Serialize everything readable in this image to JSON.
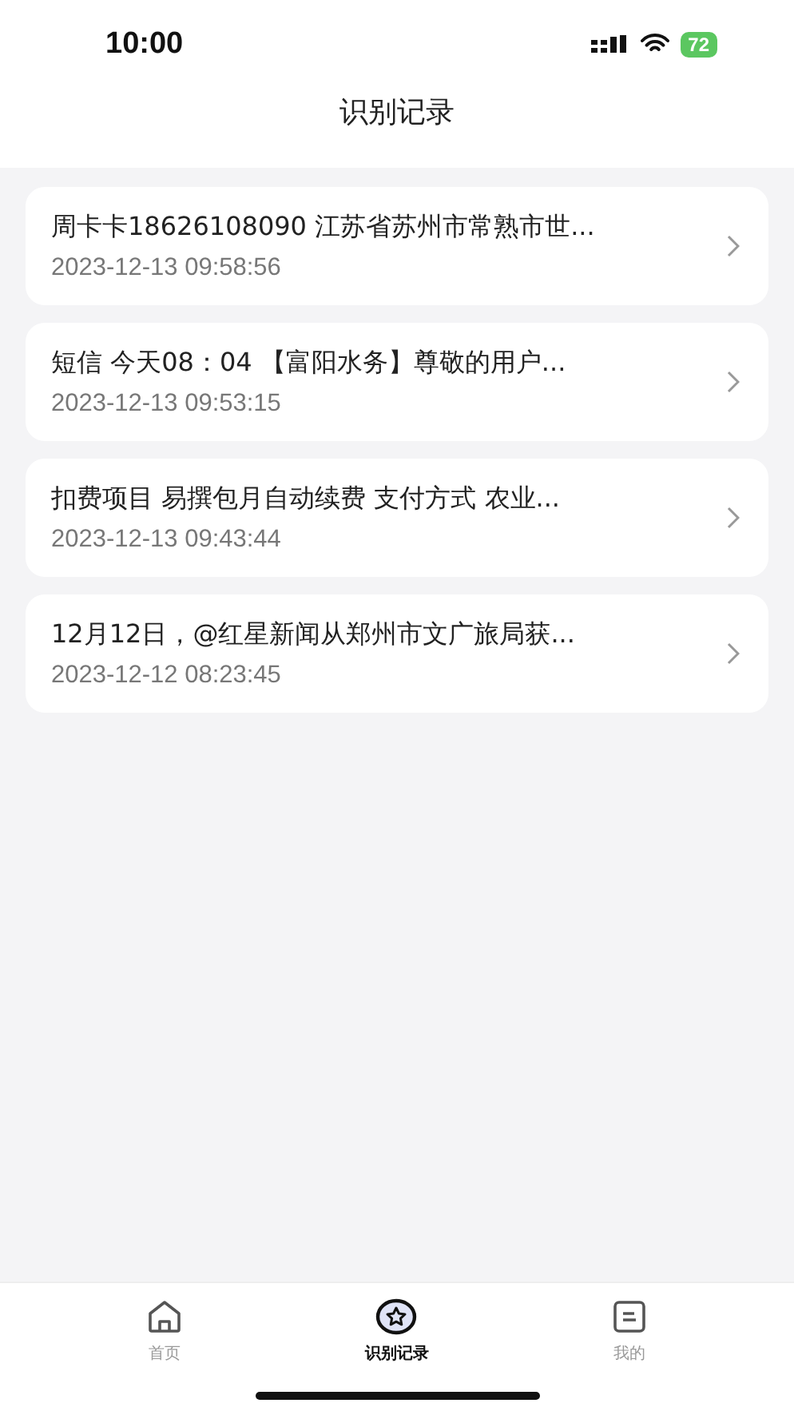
{
  "status_bar": {
    "time": "10:00",
    "battery": "72"
  },
  "header": {
    "title": "识别记录"
  },
  "records": [
    {
      "text": "周卡卡18626108090 江苏省苏州市常熟市世...",
      "date": "2023-12-13 09:58:56"
    },
    {
      "text": "短信 今天08：04 【富阳水务】尊敬的用户...",
      "date": "2023-12-13 09:53:15"
    },
    {
      "text": "扣费项目 易撰包月自动续费 支付方式 农业...",
      "date": "2023-12-13 09:43:44"
    },
    {
      "text": "12月12日，@红星新闻从郑州市文广旅局获...",
      "date": "2023-12-12 08:23:45"
    }
  ],
  "tab_bar": [
    {
      "kind": "home",
      "label": "首页",
      "selected": false
    },
    {
      "kind": "records",
      "label": "识别记录",
      "selected": true
    },
    {
      "kind": "profile",
      "label": "我的",
      "selected": false
    }
  ]
}
